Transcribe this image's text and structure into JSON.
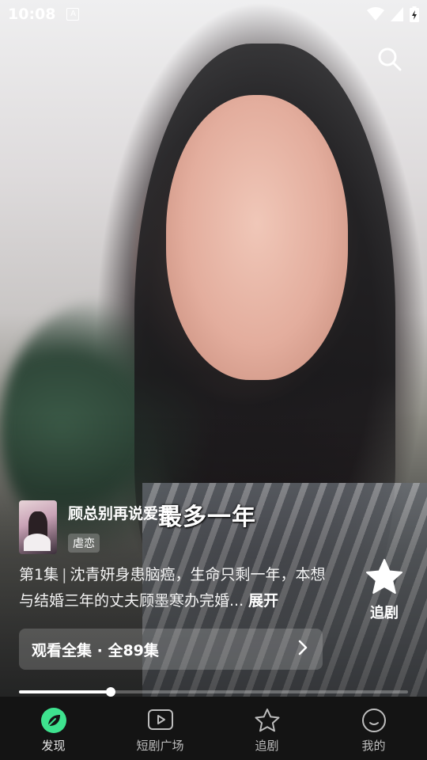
{
  "status_bar": {
    "time": "10:08",
    "notification_glyph": "A"
  },
  "player": {
    "subtitle": "最多一年",
    "progress_fraction": 0.235
  },
  "drama": {
    "title": "顾总别再说爱我",
    "tag": "虐恋",
    "episode": "第1集",
    "separator": "|",
    "description": "沈青妍身患脑癌，生命只剩一年，本想与结婚三年的丈夫顾墨寒办完婚...",
    "expand_label": "展开"
  },
  "follow_button": {
    "label": "追剧"
  },
  "watch_all": {
    "label": "观看全集 · 全89集"
  },
  "tab_bar": {
    "tabs": [
      {
        "label": "发现",
        "icon": "leaf-icon",
        "active": true
      },
      {
        "label": "短剧广场",
        "icon": "play-square-icon",
        "active": false
      },
      {
        "label": "追剧",
        "icon": "star-outline-icon",
        "active": false
      },
      {
        "label": "我的",
        "icon": "smile-circle-icon",
        "active": false
      }
    ]
  },
  "colors": {
    "accent": "#3ee38f",
    "tabbar_bg": "#141414"
  }
}
